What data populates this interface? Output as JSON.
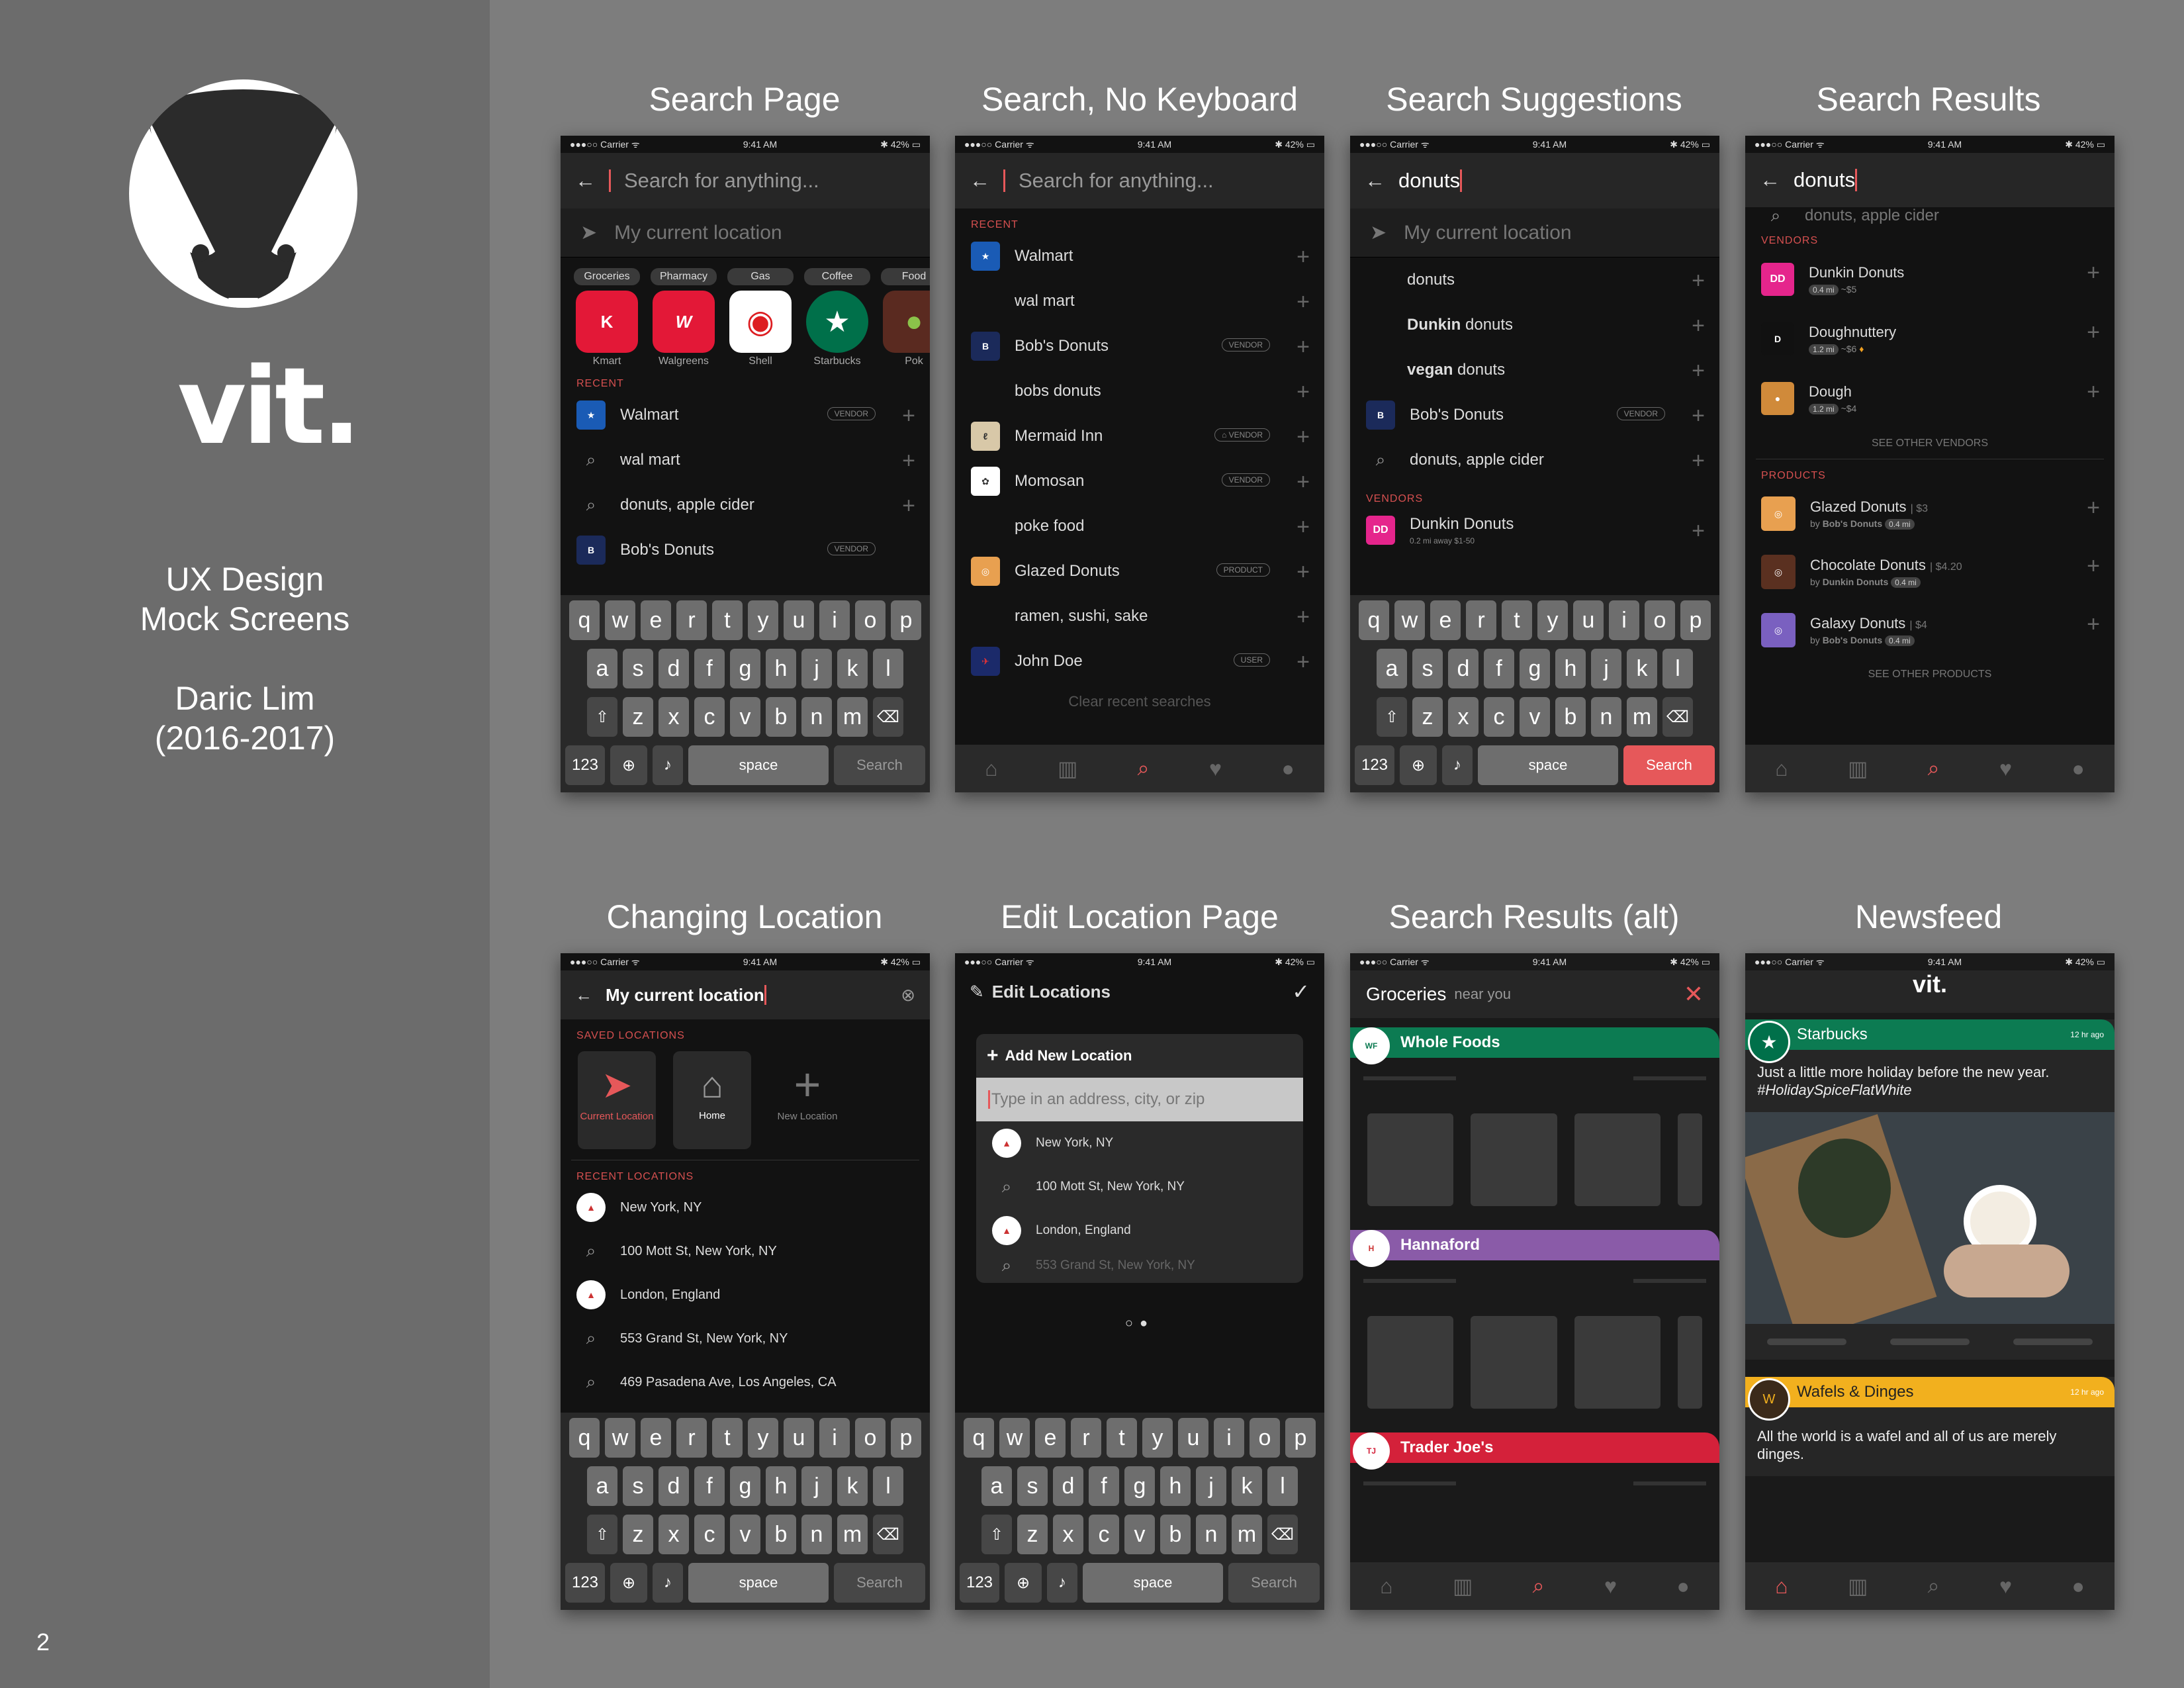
{
  "brand": {
    "name": "vit.",
    "subtitle1": "UX Design",
    "subtitle2": "Mock Screens",
    "author": "Daric Lim",
    "years": "(2016-2017)",
    "page_number": "2"
  },
  "status": {
    "carrier": "●●●○○ Carrier ᯤ",
    "time": "9:41 AM",
    "battery": "✱ 42% ▭"
  },
  "titles": [
    "Search Page",
    "Search, No Keyboard",
    "Search Suggestions",
    "Search Results",
    "Changing Location",
    "Edit Location Page",
    "Search Results (alt)",
    "Newsfeed"
  ],
  "search": {
    "placeholder": "Search for anything...",
    "location": "My current location",
    "query": "donuts"
  },
  "categories": [
    {
      "label": "Groceries",
      "name": "Kmart",
      "logo": "K",
      "bg": "#e31837",
      "fg": "#fff"
    },
    {
      "label": "Pharmacy",
      "name": "Walgreens",
      "logo": "W",
      "bg": "#e31837",
      "fg": "#fff"
    },
    {
      "label": "Gas",
      "name": "Shell",
      "logo": "◉",
      "bg": "#ffd500",
      "fg": "#dd1d21"
    },
    {
      "label": "Coffee",
      "name": "Starbucks",
      "logo": "★",
      "bg": "#00704a",
      "fg": "#fff"
    },
    {
      "label": "Food",
      "name": "Pok",
      "logo": "●",
      "bg": "#5a2a20",
      "fg": "#8bc34a"
    }
  ],
  "section": {
    "recent": "RECENT",
    "vendors": "VENDORS",
    "products": "PRODUCTS",
    "saved": "SAVED LOCATIONS",
    "recent_loc": "RECENT LOCATIONS"
  },
  "recent1": [
    {
      "text": "Walmart",
      "tag": "VENDOR",
      "icon": "wm"
    },
    {
      "text": "wal mart",
      "tag": "",
      "icon": "search"
    },
    {
      "text": "donuts, apple cider",
      "tag": "",
      "icon": "search"
    },
    {
      "text": "Bob's Donuts",
      "tag": "VENDOR",
      "icon": "bob"
    }
  ],
  "recent2": [
    {
      "text": "Walmart",
      "tag": "",
      "icon": "wm"
    },
    {
      "text": "wal mart",
      "tag": "",
      "icon": ""
    },
    {
      "text": "Bob's Donuts",
      "tag": "VENDOR",
      "icon": "bob"
    },
    {
      "text": "bobs donuts",
      "tag": "",
      "icon": ""
    },
    {
      "text": "Mermaid Inn",
      "tag": "⌂ VENDOR",
      "icon": "mer"
    },
    {
      "text": "Momosan",
      "tag": "VENDOR",
      "icon": "mom"
    },
    {
      "text": "poke food",
      "tag": "",
      "icon": ""
    },
    {
      "text": "Glazed Donuts",
      "tag": "PRODUCT",
      "icon": "gd"
    },
    {
      "text": "ramen, sushi, sake",
      "tag": "",
      "icon": ""
    },
    {
      "text": "John Doe",
      "tag": "USER",
      "icon": "jd"
    }
  ],
  "clear_recent": "Clear recent searches",
  "suggestions": [
    {
      "pre": "",
      "bold": "",
      "post": "donuts"
    },
    {
      "pre": "",
      "bold": "Dunkin",
      "post": " donuts"
    },
    {
      "pre": "",
      "bold": "vegan",
      "post": " donuts"
    }
  ],
  "sugg_bob": "Bob's Donuts",
  "sugg_bob_tag": "VENDOR",
  "sugg_search": "donuts, apple cider",
  "sugg_vendor": {
    "name": "Dunkin Donuts",
    "meta": "0.2 mi away  $1-50"
  },
  "results_partial": "donuts, apple cider",
  "vendors": [
    {
      "name": "Dunkin Donuts",
      "dist": "0.4 mi",
      "price": "~$5",
      "logo": "DD",
      "bg": "#e5258c"
    },
    {
      "name": "Doughnuttery",
      "dist": "1.2 mi",
      "price": "~$6",
      "logo": "D",
      "bg": "#111"
    },
    {
      "name": "Dough",
      "dist": "1.2 mi",
      "price": "~$4",
      "logo": "●",
      "bg": "#d08a3a"
    }
  ],
  "see_vendors": "SEE OTHER VENDORS",
  "products": [
    {
      "name": "Glazed Donuts",
      "price": "$3",
      "by": "Bob's Donuts",
      "dist": "0.4 mi",
      "bg": "#e8a050"
    },
    {
      "name": "Chocolate Donuts",
      "price": "$4.20",
      "by": "Dunkin Donuts",
      "dist": "0.4 mi",
      "bg": "#5a3020"
    },
    {
      "name": "Galaxy Donuts",
      "price": "$4",
      "by": "Bob's Donuts",
      "dist": "0.4 mi",
      "bg": "#7a60c0"
    }
  ],
  "see_products": "SEE OTHER PRODUCTS",
  "saved": [
    {
      "label": "Current Location",
      "color": "#e6585a"
    },
    {
      "label": "Home",
      "color": "#fff"
    },
    {
      "label": "New Location",
      "color": "#888"
    }
  ],
  "recent_locations": [
    "New York, NY",
    "100 Mott St, New York, NY",
    "London, England",
    "553 Grand St, New York, NY",
    "469 Pasadena Ave, Los Angeles, CA"
  ],
  "edit": {
    "title": "Edit Locations",
    "add": "Add New Location",
    "placeholder": "Type in an address, city, or zip",
    "items": [
      "New York, NY",
      "100 Mott St, New York, NY",
      "London, England",
      "553 Grand St, New York, NY"
    ]
  },
  "groceries": {
    "title": "Groceries",
    "near": "near you",
    "stores": [
      {
        "name": "Whole Foods",
        "color": "#0c7b52"
      },
      {
        "name": "Hannaford",
        "color": "#8a5ba8"
      },
      {
        "name": "Trader Joe's",
        "color": "#d4213a"
      }
    ]
  },
  "newsfeed": [
    {
      "name": "Starbucks",
      "ago": "12 hr ago",
      "color": "#0c7b52",
      "text": "Just a little more holiday before the new year.",
      "tag": "#HolidaySpiceFlatWhite"
    },
    {
      "name": "Wafels & Dinges",
      "ago": "12 hr ago",
      "color": "#f2b01e",
      "text": "All the world is a wafel and all of us are merely dinges.",
      "tag": ""
    }
  ],
  "keyboard": {
    "row1": [
      "q",
      "w",
      "e",
      "r",
      "t",
      "y",
      "u",
      "i",
      "o",
      "p"
    ],
    "row2": [
      "a",
      "s",
      "d",
      "f",
      "g",
      "h",
      "j",
      "k",
      "l"
    ],
    "row3": [
      "z",
      "x",
      "c",
      "v",
      "b",
      "n",
      "m"
    ],
    "num": "123",
    "space": "space",
    "go": "Search"
  }
}
